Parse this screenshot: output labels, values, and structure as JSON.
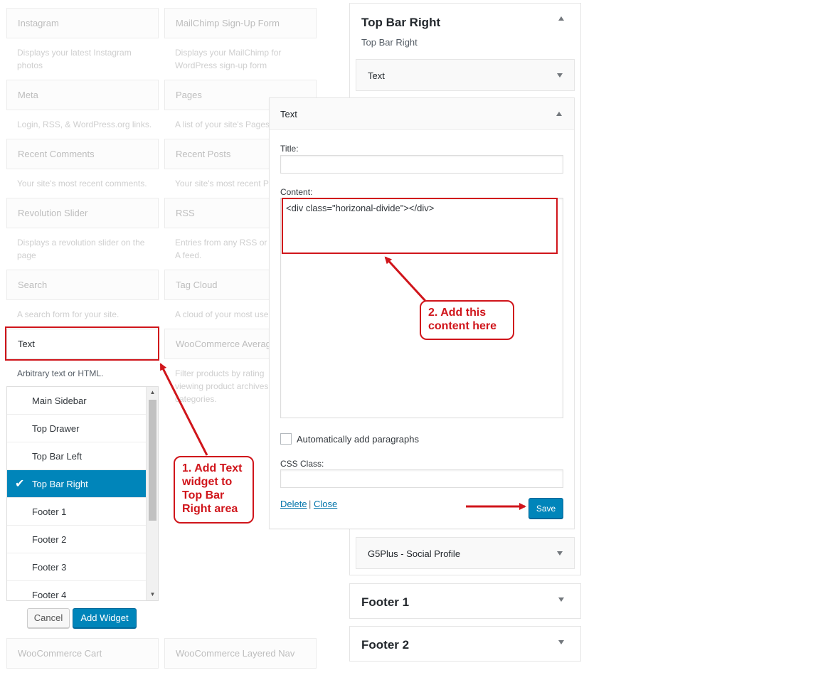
{
  "available_widgets": [
    {
      "title": "Instagram",
      "desc": "Displays your latest Instagram photos"
    },
    {
      "title": "MailChimp Sign-Up Form",
      "desc": "Displays your MailChimp for WordPress sign-up form"
    },
    {
      "title": "Meta",
      "desc": "Login, RSS, & WordPress.org links."
    },
    {
      "title": "Pages",
      "desc": "A list of your site's Pages."
    },
    {
      "title": "Recent Comments",
      "desc": "Your site's most recent comments."
    },
    {
      "title": "Recent Posts",
      "desc": "Your site's most recent Po"
    },
    {
      "title": "Revolution Slider",
      "desc": "Displays a revolution slider on the page"
    },
    {
      "title": "RSS",
      "desc": "Entries from any RSS or A feed."
    },
    {
      "title": "Search",
      "desc": "A search form for your site."
    },
    {
      "title": "Tag Cloud",
      "desc": "A cloud of your most use"
    },
    {
      "title": "Text",
      "desc": "Arbitrary text or HTML."
    },
    {
      "title": "WooCommerce Averag",
      "desc": "Filter products by rating viewing product archives categories."
    },
    {
      "title": "WooCommerce Cart",
      "desc": ""
    },
    {
      "title": "WooCommerce Layered Nav",
      "desc": ""
    }
  ],
  "chooser": {
    "items": [
      "Main Sidebar",
      "Top Drawer",
      "Top Bar Left",
      "Top Bar Right",
      "Footer 1",
      "Footer 2",
      "Footer 3",
      "Footer 4"
    ],
    "selected_index": 3,
    "cancel_label": "Cancel",
    "add_label": "Add Widget"
  },
  "top_bar_right": {
    "title": "Top Bar Right",
    "description": "Top Bar Right",
    "collapsed_widget": "Text",
    "social_widget": "G5Plus - Social Profile"
  },
  "editor": {
    "title": "Text",
    "title_label": "Title:",
    "title_value": "",
    "content_label": "Content:",
    "content_value": "<div class=\"horizonal-divide\"></div>",
    "auto_paragraphs_label": "Automatically add paragraphs",
    "css_class_label": "CSS Class:",
    "css_class_value": "",
    "delete_label": "Delete",
    "separator": "|",
    "close_label": "Close",
    "save_label": "Save"
  },
  "other_sidebars": [
    "Footer 1",
    "Footer 2"
  ],
  "callouts": {
    "step1": "1. Add Text widget to Top Bar Right  area",
    "step2": "2. Add this content here"
  },
  "colors": {
    "accent": "#0085ba",
    "annotation": "#d0151b"
  }
}
